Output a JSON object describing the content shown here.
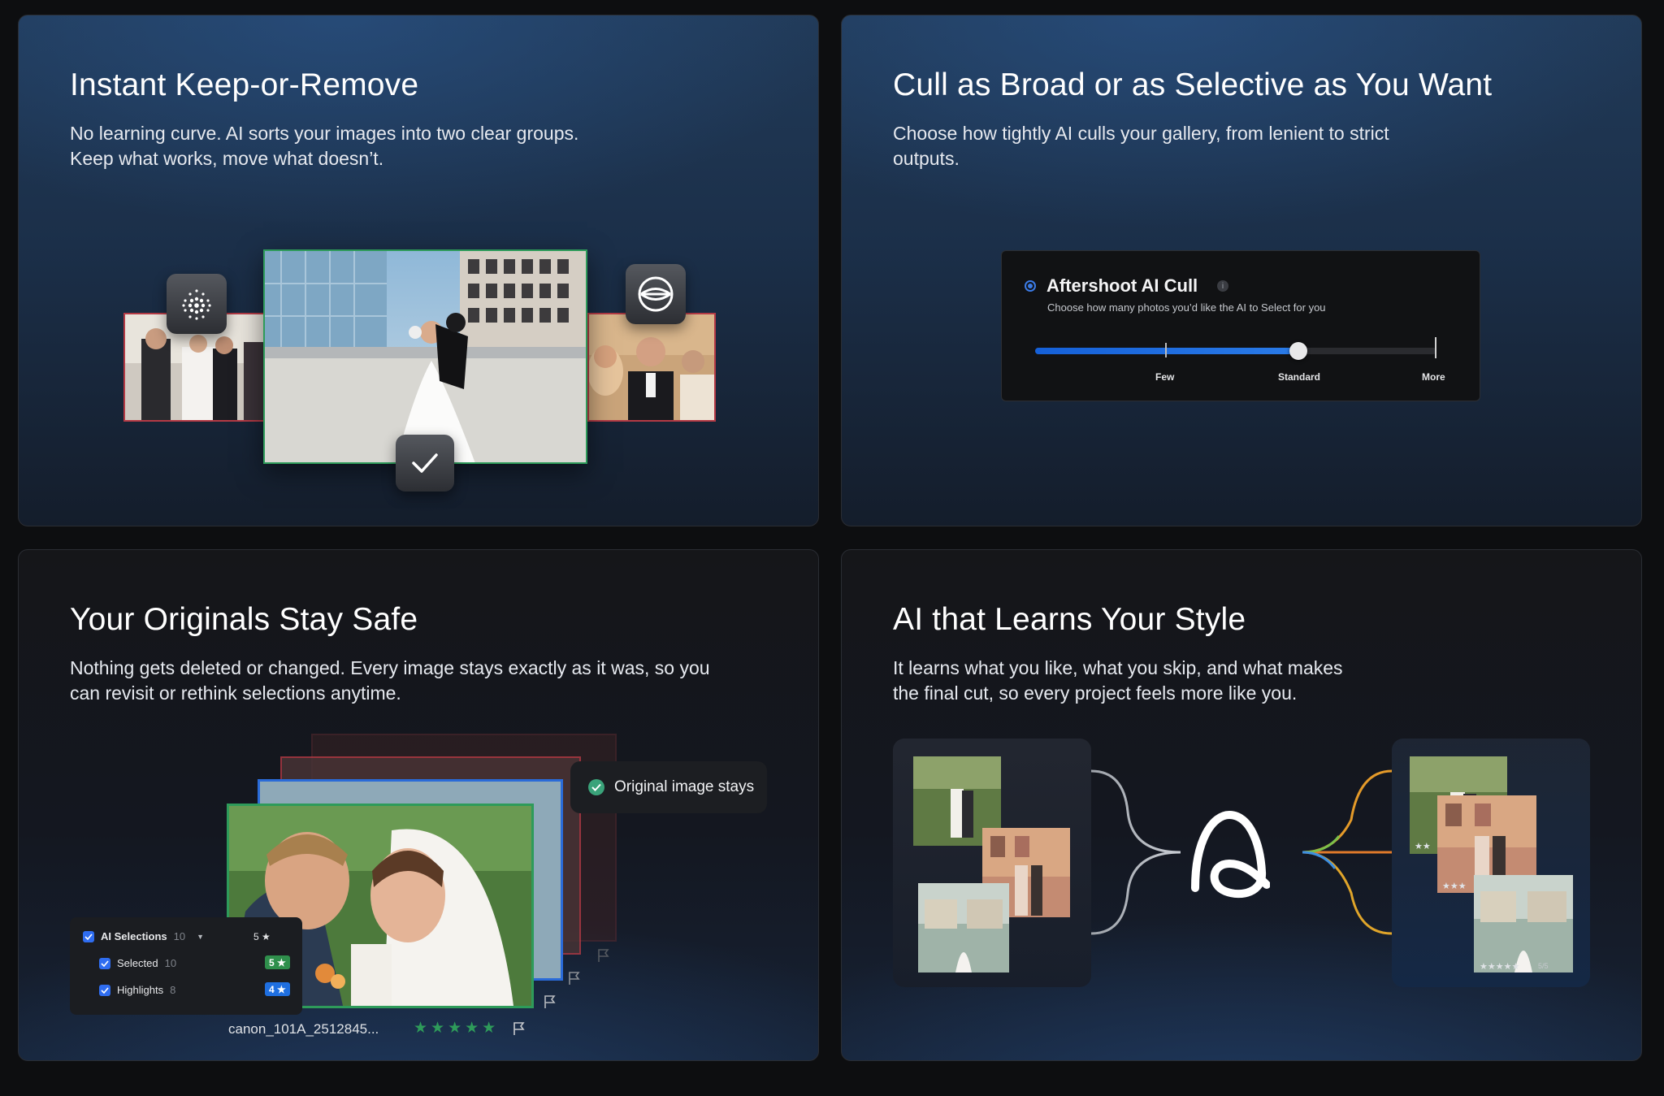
{
  "cards": {
    "keep_remove": {
      "title": "Instant Keep-or-Remove",
      "desc_line1": "No learning curve. AI sorts your images into two clear groups.",
      "desc_line2": "Keep what works, move what doesn’t."
    },
    "cull_range": {
      "title": "Cull as Broad or as Selective as You Want",
      "desc_line1": "Choose how tightly AI culls your gallery, from lenient to strict",
      "desc_line2": "outputs.",
      "widget": {
        "title": "Aftershoot AI Cull",
        "subtitle": "Choose how many photos you’d like the AI to Select for you",
        "labels": [
          "Few",
          "Standard",
          "More"
        ],
        "slider_value": 0.66
      }
    },
    "originals_safe": {
      "title": "Your Originals Stay Safe",
      "desc_line1": "Nothing gets deleted or changed. Every image stays exactly as it was, so you",
      "desc_line2": "can revisit or rethink selections anytime.",
      "badge": "Original image stays",
      "filename": "canon_101A_2512845...",
      "rating": 5,
      "panel": {
        "ai_selections": {
          "label": "AI Selections",
          "count": "10",
          "stars": "5"
        },
        "selected": {
          "label": "Selected",
          "count": "10",
          "stars": "5"
        },
        "highlights": {
          "label": "Highlights",
          "count": "8",
          "stars": "4"
        }
      }
    },
    "learns_style": {
      "title": "AI that Learns Your Style",
      "desc_line1": "It learns what you like, what you skip, and what makes",
      "desc_line2": "the final cut, so every project feels more like you.",
      "ratings": [
        "★★",
        "★★★",
        "★★★★★"
      ],
      "score": "5/5"
    }
  },
  "colors": {
    "accent_blue": "#1f6fe0",
    "keep_green": "#2e9b5a",
    "reject_red": "#b43a45"
  }
}
